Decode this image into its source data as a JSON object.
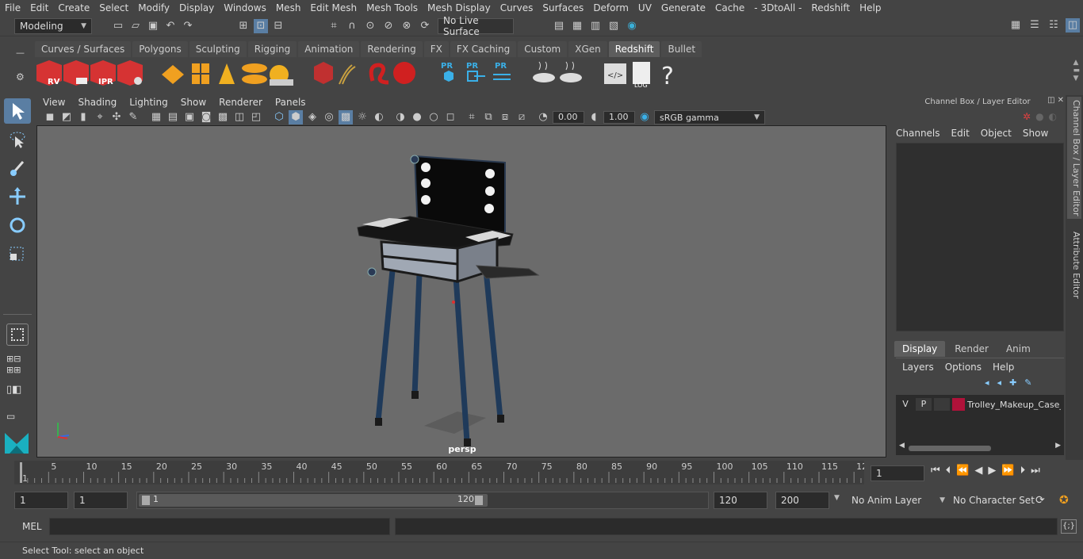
{
  "menubar": [
    "File",
    "Edit",
    "Create",
    "Select",
    "Modify",
    "Display",
    "Windows",
    "Mesh",
    "Edit Mesh",
    "Mesh Tools",
    "Mesh Display",
    "Curves",
    "Surfaces",
    "Deform",
    "UV",
    "Generate",
    "Cache",
    "- 3DtoAll -",
    "Redshift",
    "Help"
  ],
  "toolbar": {
    "mode": "Modeling",
    "live_surface": "No Live Surface"
  },
  "shelf_tabs": [
    "Curves / Surfaces",
    "Polygons",
    "Sculpting",
    "Rigging",
    "Animation",
    "Rendering",
    "FX",
    "FX Caching",
    "Custom",
    "XGen",
    "Redshift",
    "Bullet"
  ],
  "active_shelf": "Redshift",
  "shelf_labels": {
    "rv": "RV",
    "ipr": "IPR",
    "pr": "PR",
    "log": "LOG",
    "help": "?"
  },
  "viewport": {
    "menus": [
      "View",
      "Shading",
      "Lighting",
      "Show",
      "Renderer",
      "Panels"
    ],
    "exposure": "0.00",
    "gamma": "1.00",
    "colorspace": "sRGB gamma",
    "camera_label": "persp"
  },
  "channel_box": {
    "title": "Channel Box / Layer Editor",
    "menus": [
      "Channels",
      "Edit",
      "Object",
      "Show"
    ]
  },
  "layer_editor": {
    "tabs": [
      "Display",
      "Render",
      "Anim"
    ],
    "active_tab": "Display",
    "menus": [
      "Layers",
      "Options",
      "Help"
    ],
    "layer": {
      "v": "V",
      "p": "P",
      "name": "Trolley_Makeup_Case_",
      "color": "#b0123a"
    }
  },
  "side_tabs": [
    "Channel Box / Layer Editor",
    "Attribute Editor"
  ],
  "timeline": {
    "ticks": [
      "1",
      "5",
      "10",
      "15",
      "20",
      "25",
      "30",
      "35",
      "40",
      "45",
      "50",
      "55",
      "60",
      "65",
      "70",
      "75",
      "80",
      "85",
      "90",
      "95",
      "100",
      "105",
      "110",
      "115",
      "12"
    ],
    "current_frame": "1"
  },
  "range": {
    "start": "1",
    "start2": "1",
    "slider_start": "1",
    "slider_end": "120",
    "end": "120",
    "end2": "200",
    "anim_layer": "No Anim Layer",
    "char_set": "No Character Set"
  },
  "mel": {
    "label": "MEL"
  },
  "status": "Select Tool: select an object"
}
